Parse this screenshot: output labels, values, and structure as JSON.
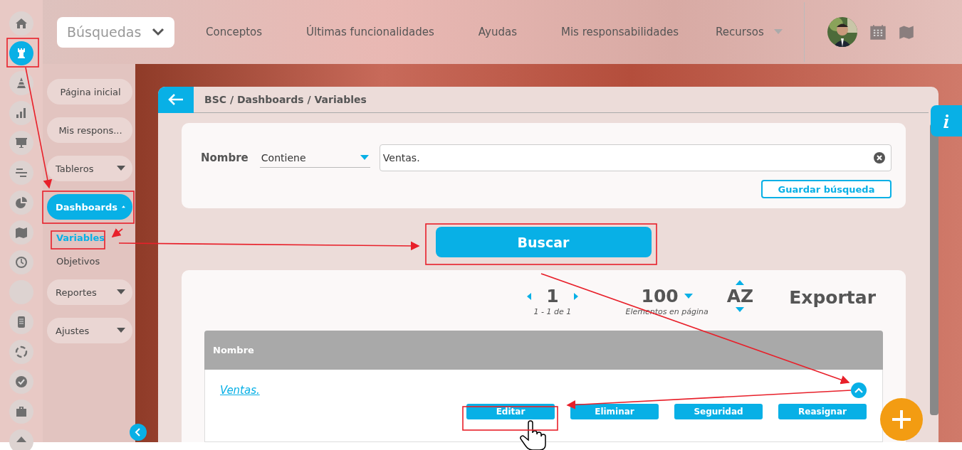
{
  "rail": [
    {
      "selected": false
    },
    {
      "selected": true
    },
    {
      "selected": false
    },
    {
      "selected": false
    },
    {
      "selected": false
    },
    {
      "selected": false
    },
    {
      "selected": false
    },
    {
      "selected": false
    },
    {
      "selected": false
    },
    {
      "selected": false
    },
    {
      "selected": false
    },
    {
      "selected": false
    },
    {
      "selected": false
    },
    {
      "selected": false
    },
    {
      "selected": false
    }
  ],
  "top_bar": {
    "search_menu": "Búsquedas",
    "links": [
      "Conceptos",
      "Últimas funcionalidades",
      "Ayudas",
      "Mis responsabilidades",
      "Recursos"
    ]
  },
  "sidebar": {
    "items": [
      {
        "kind": "pill",
        "label": "Página inicial",
        "selected": false
      },
      {
        "kind": "pill",
        "label": "Mis respons...",
        "selected": false
      },
      {
        "kind": "group",
        "label": "Tableros",
        "expanded": false,
        "selected": false
      },
      {
        "kind": "group",
        "label": "Dashboards",
        "expanded": true,
        "selected": true
      },
      {
        "kind": "sub",
        "label": "Variables",
        "selected": true
      },
      {
        "kind": "sub",
        "label": "Objetivos",
        "selected": false
      },
      {
        "kind": "group",
        "label": "Reportes",
        "expanded": false,
        "selected": false
      },
      {
        "kind": "group",
        "label": "Ajustes",
        "expanded": false,
        "selected": false
      }
    ]
  },
  "breadcrumb": "BSC / Dashboards / Variables",
  "filter": {
    "label": "Nombre",
    "operator": "Contiene",
    "value": "Ventas.",
    "save_button": "Guardar búsqueda"
  },
  "search_button": "Buscar",
  "results": {
    "page": "1",
    "range": "1 - 1 de 1",
    "per_page": "100",
    "per_page_label": "Elementos en página",
    "sort": "AZ",
    "export": "Exportar",
    "table": {
      "columns": [
        "Nombre"
      ],
      "rows": [
        {
          "name": "Ventas.",
          "expanded": true,
          "actions": [
            "Editar",
            "Eliminar",
            "Seguridad",
            "Reasignar"
          ]
        }
      ]
    }
  }
}
